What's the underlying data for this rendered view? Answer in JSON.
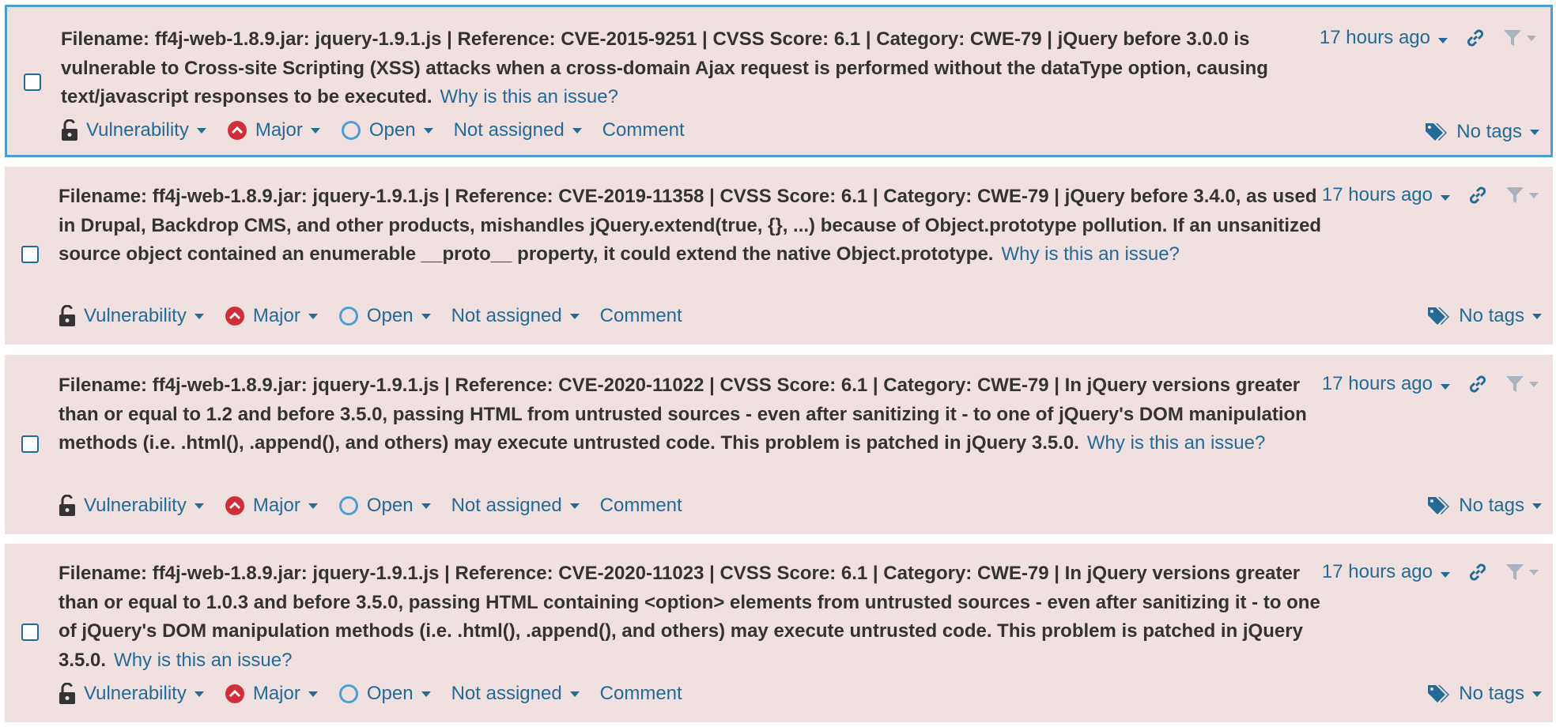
{
  "common": {
    "type_label": "Vulnerability",
    "severity_label": "Major",
    "status_label": "Open",
    "assignee_label": "Not assigned",
    "comment_label": "Comment",
    "tags_label": "No tags",
    "why_label": "Why is this an issue?",
    "time_label": "17 hours ago"
  },
  "issues": [
    {
      "message": "Filename: ff4j-web-1.8.9.jar: jquery-1.9.1.js | Reference: CVE-2015-9251 | CVSS Score: 6.1 | Category: CWE-79 | jQuery before 3.0.0 is vulnerable to Cross-site Scripting (XSS) attacks when a cross-domain Ajax request is performed without the dataType option, causing text/javascript responses to be executed.",
      "selected": true
    },
    {
      "message": "Filename: ff4j-web-1.8.9.jar: jquery-1.9.1.js | Reference: CVE-2019-11358 | CVSS Score: 6.1 | Category: CWE-79 | jQuery before 3.4.0, as used in Drupal, Backdrop CMS, and other products, mishandles jQuery.extend(true, {}, ...) because of Object.prototype pollution. If an unsanitized source object contained an enumerable __proto__ property, it could extend the native Object.prototype.",
      "selected": false
    },
    {
      "message": "Filename: ff4j-web-1.8.9.jar: jquery-1.9.1.js | Reference: CVE-2020-11022 | CVSS Score: 6.1 | Category: CWE-79 | In jQuery versions greater than or equal to 1.2 and before 3.5.0, passing HTML from untrusted sources - even after sanitizing it - to one of jQuery's DOM manipulation methods (i.e. .html(), .append(), and others) may execute untrusted code. This problem is patched in jQuery 3.5.0.",
      "selected": false
    },
    {
      "message": "Filename: ff4j-web-1.8.9.jar: jquery-1.9.1.js | Reference: CVE-2020-11023 | CVSS Score: 6.1 | Category: CWE-79 | In jQuery versions greater than or equal to 1.0.3 and before 3.5.0, passing HTML containing <option> elements from untrusted sources - even after sanitizing it - to one of jQuery's DOM manipulation methods (i.e. .html(), .append(), and others) may execute untrusted code. This problem is patched in jQuery 3.5.0.",
      "selected": false
    }
  ],
  "colors": {
    "card_background": "#f0e0e0",
    "link_blue": "#236a97",
    "selected_border": "#4b9fd5",
    "severity_major_red": "#d02f3a",
    "muted_icon": "#a9b4c0"
  },
  "icons": {
    "type": "unlock-icon",
    "severity": "major-severity-icon",
    "status": "open-status-icon",
    "link": "permalink-icon",
    "filter": "filter-icon",
    "tags": "tags-icon"
  }
}
